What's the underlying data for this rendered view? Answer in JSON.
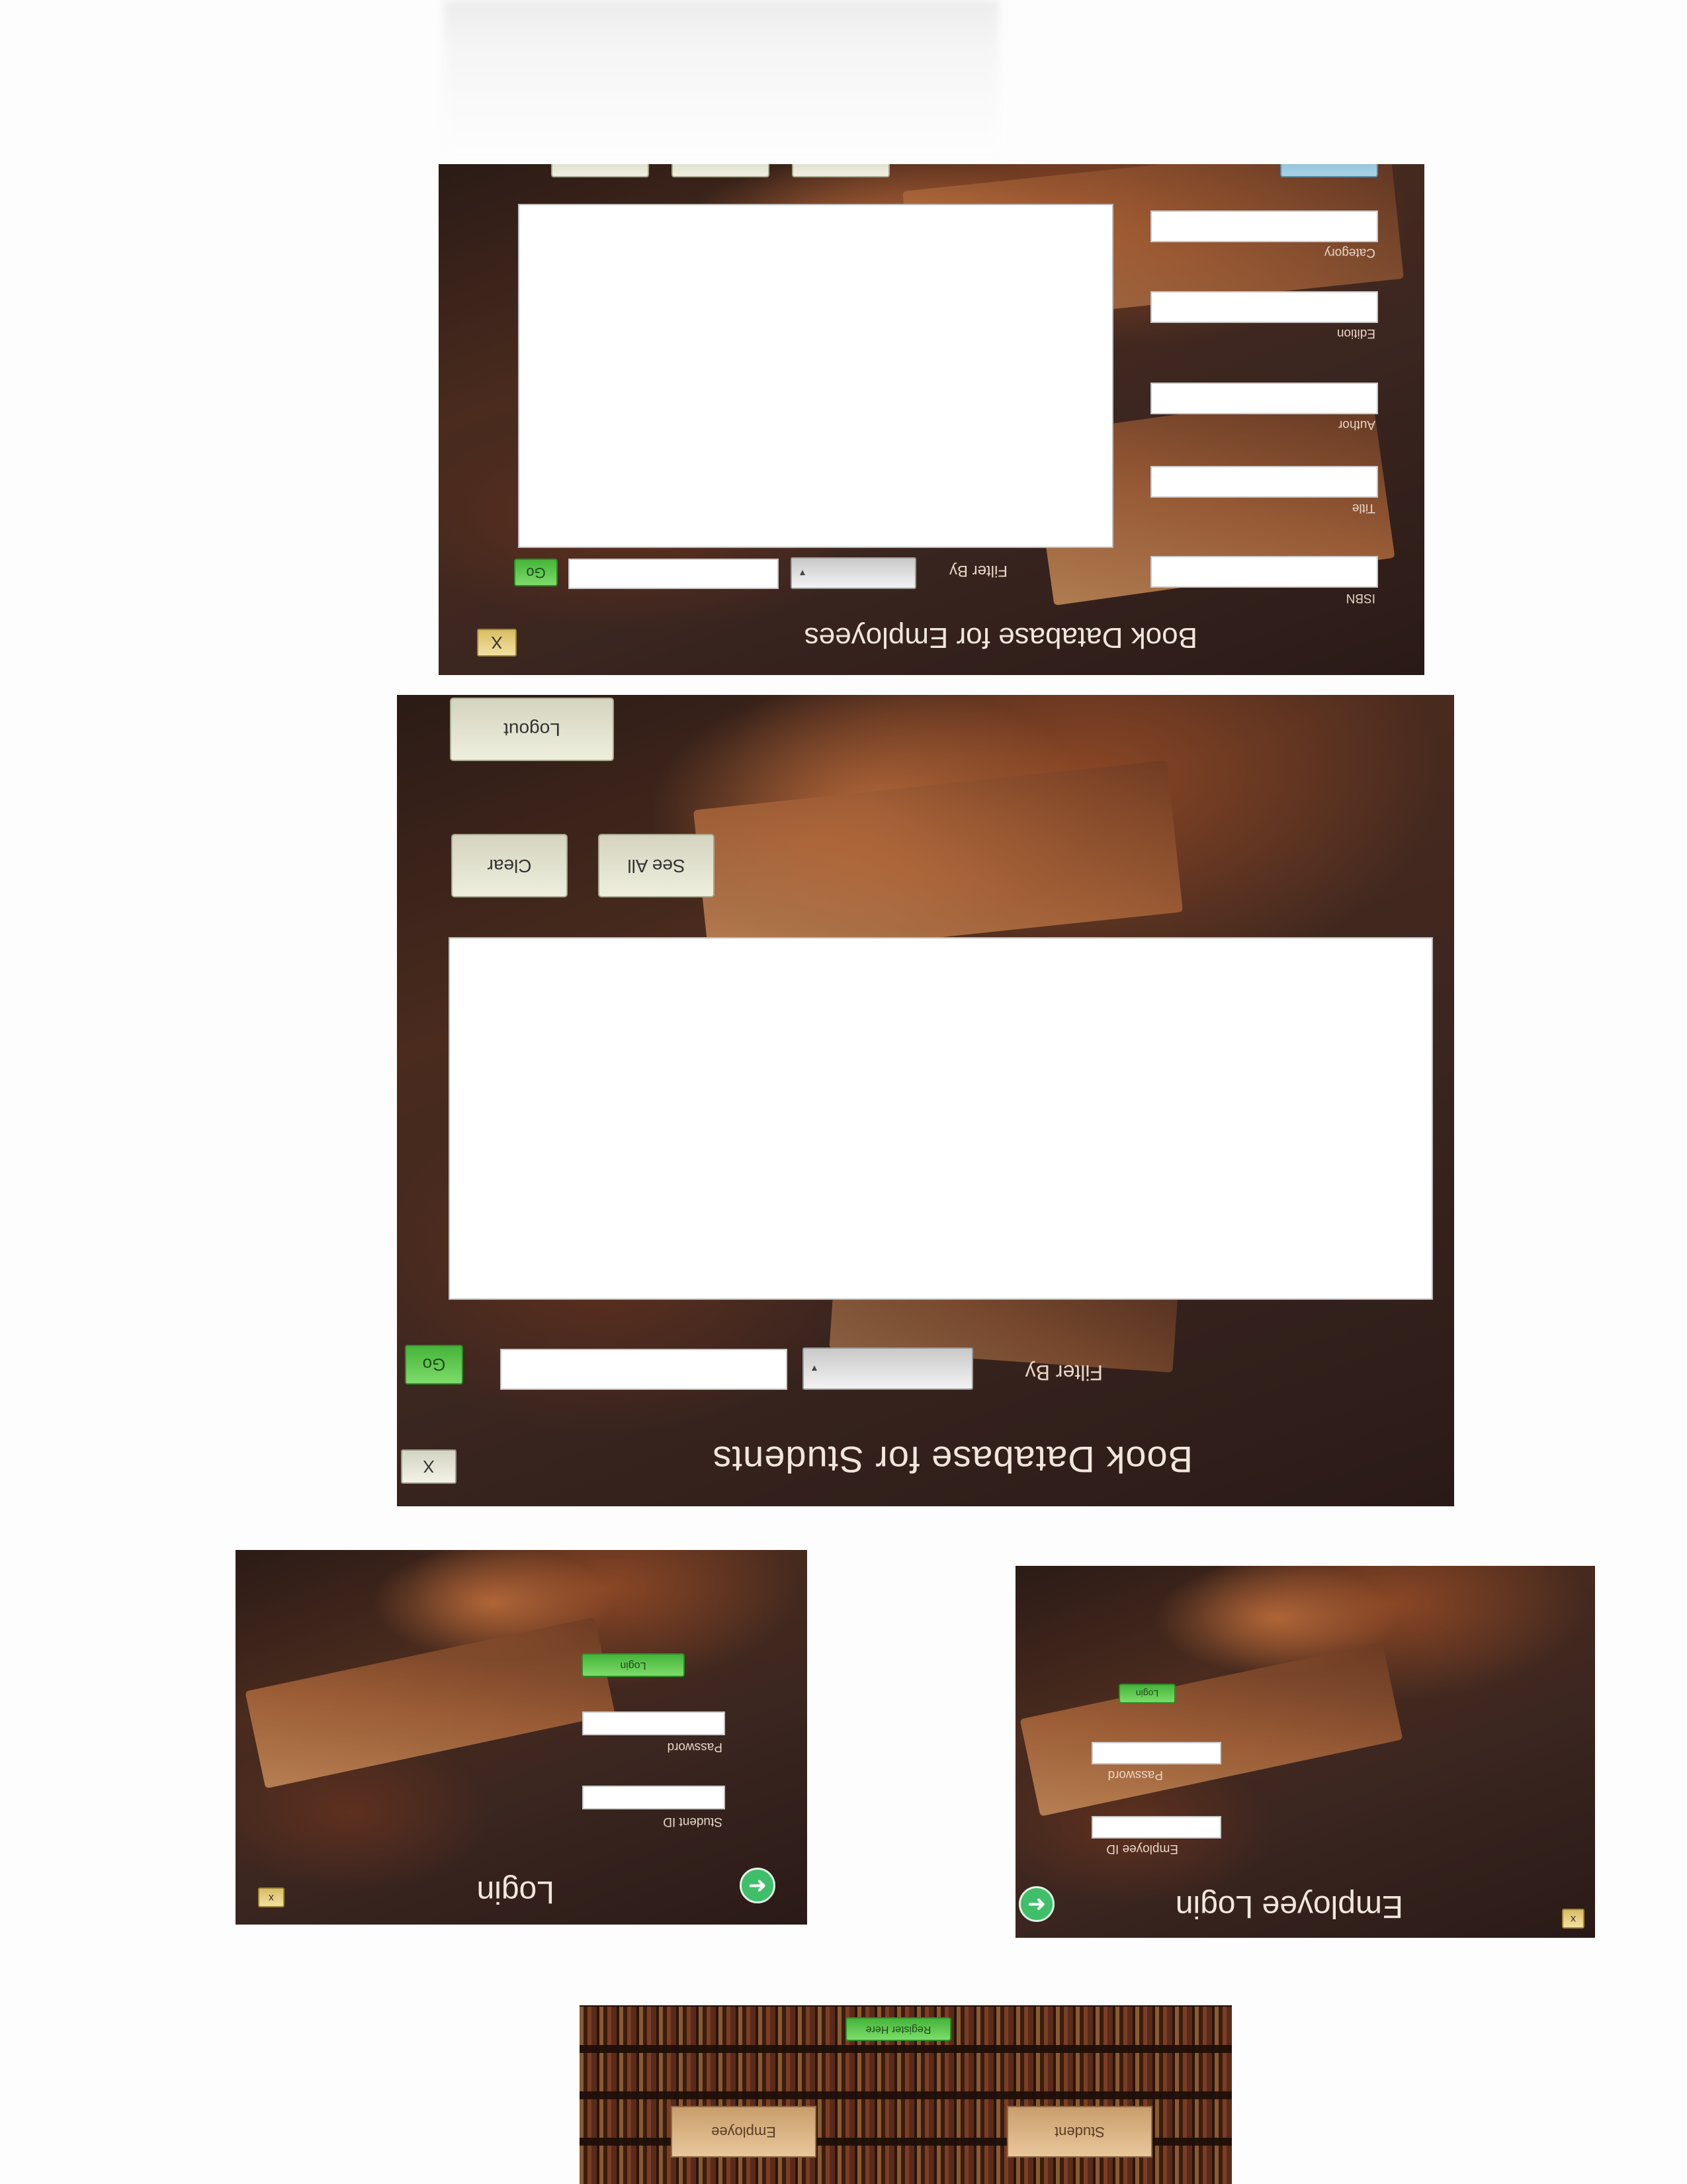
{
  "students_window": {
    "title": "Book Database for Students",
    "close_label": "X",
    "filter_label": "Filter By",
    "filter_dropdown_arrow": "▾",
    "filter_text_value": "",
    "go_label": "Go",
    "see_all_label": "See All",
    "clear_label": "Clear",
    "logout_label": "Logout"
  },
  "employees_window": {
    "title": "Book Database for Employees",
    "close_label": "X",
    "filter_label": "Filter By",
    "filter_dropdown_arrow": "▾",
    "go_label": "Go",
    "fields": {
      "isbn": "ISBN",
      "title": "Title",
      "author": "Author",
      "edition": "Edition",
      "category": "Category"
    }
  },
  "student_login": {
    "title": "Login",
    "close_label": "x",
    "student_id_label": "Student ID",
    "password_label": "Password",
    "login_label": "Login",
    "next_icon": "arrow-right-icon"
  },
  "employee_login": {
    "title": "Employee Login",
    "close_label": "x",
    "employee_id_label": "Employee ID",
    "password_label": "Password",
    "login_label": "Login",
    "next_icon": "arrow-right-icon"
  },
  "start_screen": {
    "register_label": "Register Here",
    "student_label": "Student",
    "employee_label": "Employee"
  }
}
